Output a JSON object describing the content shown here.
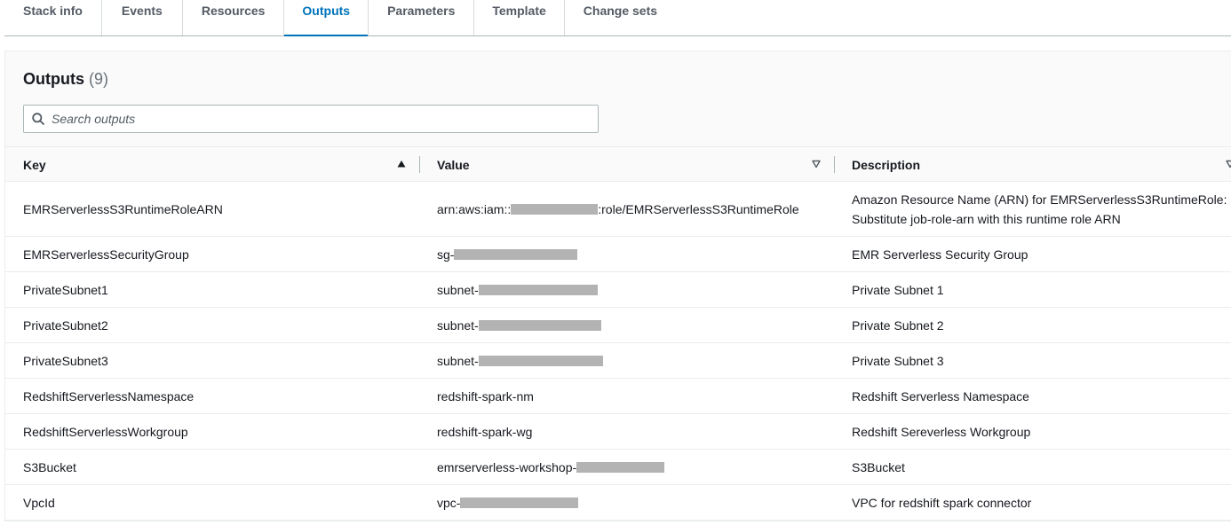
{
  "tabs": [
    {
      "label": "Stack info"
    },
    {
      "label": "Events"
    },
    {
      "label": "Resources"
    },
    {
      "label": "Outputs",
      "active": true
    },
    {
      "label": "Parameters"
    },
    {
      "label": "Template"
    },
    {
      "label": "Change sets"
    }
  ],
  "outputs": {
    "title": "Outputs",
    "count": "(9)",
    "search_placeholder": "Search outputs",
    "columns": {
      "key": "Key",
      "value": "Value",
      "description": "Description"
    },
    "rows": [
      {
        "key": "EMRServerlessS3RuntimeRoleARN",
        "value_prefix": "arn:aws:iam::",
        "value_suffix": ":role/EMRServerlessS3RuntimeRole",
        "description": "Amazon Resource Name (ARN) for EMRServerlessS3RuntimeRole: Substitute job-role-arn with this runtime role ARN"
      },
      {
        "key": "EMRServerlessSecurityGroup",
        "value_prefix": "sg-",
        "value_suffix": "",
        "description": "EMR Serverless Security Group"
      },
      {
        "key": "PrivateSubnet1",
        "value_prefix": "subnet-",
        "value_suffix": "",
        "description": "Private Subnet 1"
      },
      {
        "key": "PrivateSubnet2",
        "value_prefix": "subnet-",
        "value_suffix": "",
        "description": "Private Subnet 2"
      },
      {
        "key": "PrivateSubnet3",
        "value_prefix": "subnet-",
        "value_suffix": "",
        "description": "Private Subnet 3"
      },
      {
        "key": "RedshiftServerlessNamespace",
        "value_prefix": "redshift-spark-nm",
        "value_suffix": "",
        "description": "Redshift Serverless Namespace"
      },
      {
        "key": "RedshiftServerlessWorkgroup",
        "value_prefix": "redshift-spark-wg",
        "value_suffix": "",
        "description": "Redshift Sereverless Workgroup"
      },
      {
        "key": "S3Bucket",
        "value_prefix": "emrserverless-workshop-",
        "value_suffix": "",
        "description": "S3Bucket"
      },
      {
        "key": "VpcId",
        "value_prefix": "vpc-",
        "value_suffix": "",
        "description": "VPC for redshift spark connector"
      }
    ]
  },
  "colors": {
    "accent": "#0073bb",
    "redaction": "#b3b3b3"
  }
}
